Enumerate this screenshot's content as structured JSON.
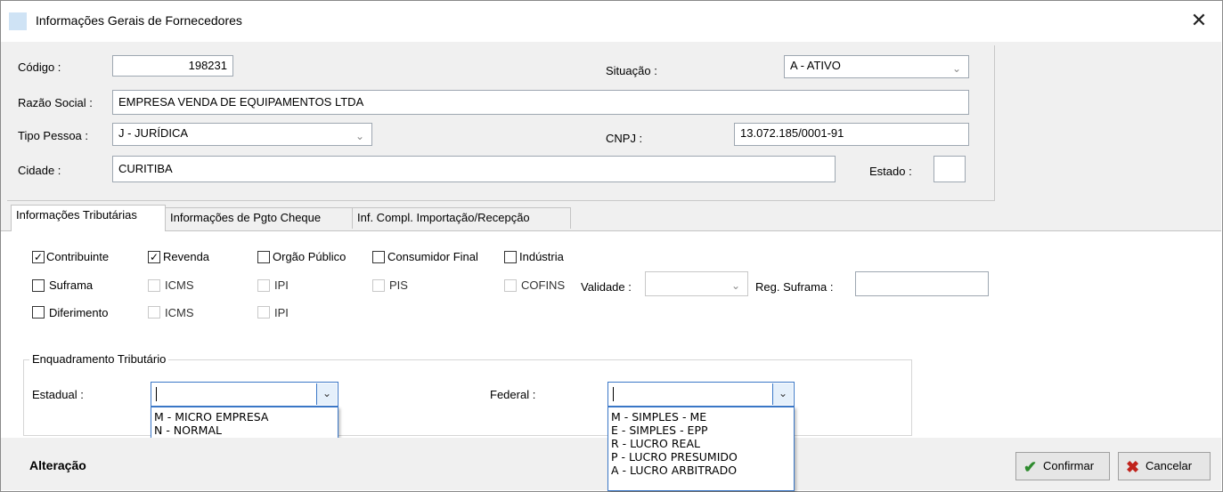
{
  "window": {
    "title": "Informações Gerais de Fornecedores",
    "close_glyph": "✕"
  },
  "header": {
    "codigo_label": "Código :",
    "codigo_value": "198231",
    "situacao_label": "Situação :",
    "situacao_value": "A - ATIVO",
    "razao_label": "Razão Social :",
    "razao_value": "EMPRESA VENDA DE EQUIPAMENTOS LTDA",
    "tipo_label": "Tipo Pessoa :",
    "tipo_value": "J - JURÍDICA",
    "cnpj_label": "CNPJ :",
    "cnpj_value": "13.072.185/0001-91",
    "cidade_label": "Cidade :",
    "cidade_value": "CURITIBA",
    "estado_label": "Estado :",
    "estado_value": ""
  },
  "tabs": [
    {
      "label": "Informações Tributárias",
      "active": true
    },
    {
      "label": "Informações de Pgto Cheque",
      "active": false
    },
    {
      "label": "Inf. Compl. Importação/Recepção",
      "active": false
    }
  ],
  "checks": {
    "contribuinte": {
      "label": "Contribuinte",
      "checked": true
    },
    "revenda": {
      "label": "Revenda",
      "checked": true
    },
    "orgao": {
      "label": "Orgão Público",
      "checked": false
    },
    "consumidor": {
      "label": "Consumidor Final",
      "checked": false
    },
    "industria": {
      "label": "Indústria",
      "checked": false
    },
    "suframa": {
      "label": "Suframa",
      "checked": false
    },
    "icms1": {
      "label": "ICMS",
      "checked": false
    },
    "ipi1": {
      "label": "IPI",
      "checked": false
    },
    "pis": {
      "label": "PIS",
      "checked": false
    },
    "cofins": {
      "label": "COFINS",
      "checked": false
    },
    "diferimento": {
      "label": "Diferimento",
      "checked": false
    },
    "icms2": {
      "label": "ICMS",
      "checked": false
    },
    "ipi2": {
      "label": "IPI",
      "checked": false
    }
  },
  "validade_label": "Validade :",
  "validade_value": "",
  "reg_suframa_label": "Reg. Suframa :",
  "reg_suframa_value": "",
  "enquadramento": {
    "title": "Enquadramento Tributário",
    "estadual_label": "Estadual :",
    "estadual_value": "",
    "estadual_options": [
      "M - MICRO EMPRESA",
      "N - NORMAL"
    ],
    "federal_label": "Federal :",
    "federal_value": "",
    "federal_options": [
      "M - SIMPLES - ME",
      "E - SIMPLES - EPP",
      "R - LUCRO REAL",
      "P - LUCRO PRESUMIDO",
      "A - LUCRO ARBITRADO"
    ]
  },
  "footer": {
    "status": "Alteração",
    "confirm_label": "Confirmar",
    "confirm_icon": "check-icon",
    "cancel_label": "Cancelar",
    "cancel_icon": "x-icon"
  },
  "colors": {
    "accent": "#3b78c8",
    "confirm_green": "#2e8b2e",
    "cancel_red": "#c0231c"
  }
}
